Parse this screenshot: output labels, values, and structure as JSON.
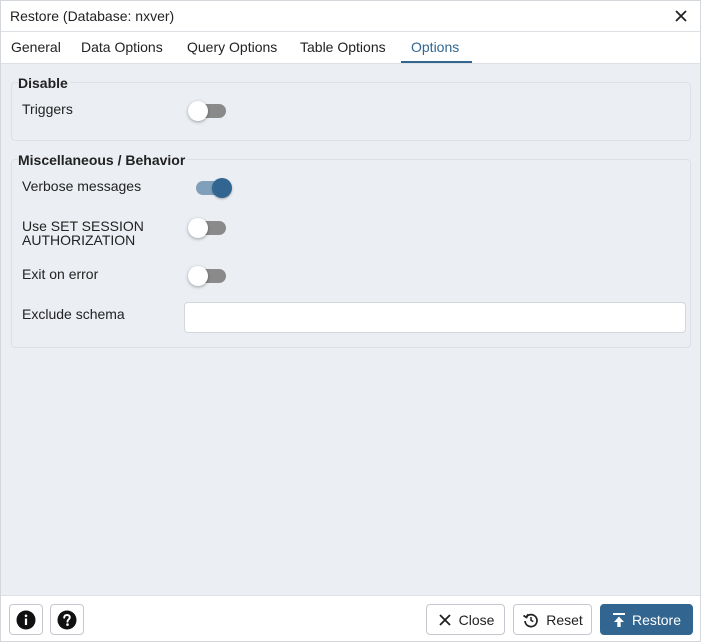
{
  "window": {
    "title": "Restore (Database: nxver)",
    "close_icon": "close-icon"
  },
  "tabs": [
    {
      "label": "General",
      "active": false
    },
    {
      "label": "Data Options",
      "active": false
    },
    {
      "label": "Query Options",
      "active": false
    },
    {
      "label": "Table Options",
      "active": false
    },
    {
      "label": "Options",
      "active": true
    }
  ],
  "sections": {
    "disable": {
      "title": "Disable",
      "triggers": {
        "label": "Triggers",
        "enabled": false
      }
    },
    "misc": {
      "title": "Miscellaneous / Behavior",
      "verbose": {
        "label": "Verbose messages",
        "enabled": true
      },
      "set_session": {
        "label_line1": "Use SET SESSION",
        "label_line2": "AUTHORIZATION",
        "enabled": false
      },
      "exit_on_error": {
        "label": "Exit on error",
        "enabled": false
      },
      "exclude_schema": {
        "label": "Exclude schema",
        "value": "",
        "placeholder": ""
      }
    }
  },
  "footer": {
    "info_icon": "info-icon",
    "help_icon": "help-icon",
    "close_label": "Close",
    "reset_label": "Reset",
    "restore_label": "Restore"
  },
  "colors": {
    "accent": "#326690",
    "background": "#ebeef3",
    "toggle_off_track": "#8a8a8a",
    "toggle_on_track": "#7f9fbb"
  }
}
